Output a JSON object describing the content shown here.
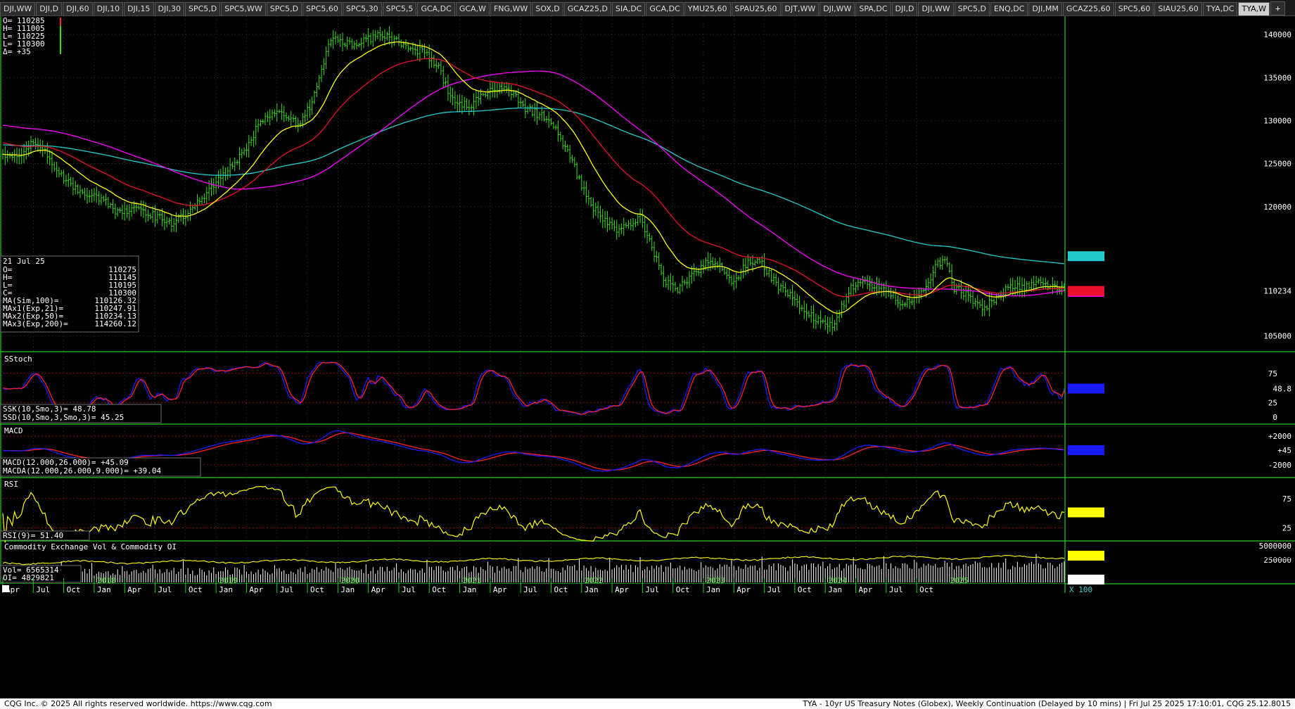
{
  "tabs": [
    {
      "label": "DJI,WW"
    },
    {
      "label": "DJI,D"
    },
    {
      "label": "DJI,60"
    },
    {
      "label": "DJI,10"
    },
    {
      "label": "DJI,15"
    },
    {
      "label": "DJI,30"
    },
    {
      "label": "SPC5,D"
    },
    {
      "label": "SPC5,WW"
    },
    {
      "label": "SPC5,D"
    },
    {
      "label": "SPC5,60"
    },
    {
      "label": "SPC5,30"
    },
    {
      "label": "SPC5,5"
    },
    {
      "label": "GCA,DC"
    },
    {
      "label": "GCA,W"
    },
    {
      "label": "FNG,WW"
    },
    {
      "label": "SOX,D"
    },
    {
      "label": "GCAZ25,D"
    },
    {
      "label": "SIA,DC"
    },
    {
      "label": "GCA,DC"
    },
    {
      "label": "YMU25,60"
    },
    {
      "label": "SPAU25,60"
    },
    {
      "label": "DJT,WW"
    },
    {
      "label": "DJI,WW"
    },
    {
      "label": "SPA,DC"
    },
    {
      "label": "DJI,D"
    },
    {
      "label": "DJI,WW"
    },
    {
      "label": "SPC5,D"
    },
    {
      "label": "ENQ,DC"
    },
    {
      "label": "DJI,MM"
    },
    {
      "label": "GCAZ25,60"
    },
    {
      "label": "SPC5,60"
    },
    {
      "label": "SIAU25,60"
    },
    {
      "label": "TYA,DC"
    },
    {
      "label": "TYA,W",
      "active": true
    }
  ],
  "tab_add": "+",
  "colors": {
    "bars": "#3cdc1e",
    "ma100": "#ff00ff",
    "ma21": "#ffff00",
    "ma50": "#e8102a",
    "ma200": "#22cccc",
    "border": "#22cc22",
    "stoch_k": "#1a1aff",
    "stoch_d": "#ff2020",
    "rsi": "#ffff00",
    "oi": "#ffff00",
    "vol": "#ffffff"
  },
  "price_panel": {
    "ohlc_box": {
      "lines": [
        "O= 110285",
        "H= 111005",
        "L= 110225",
        "L= 110300",
        "Δ=     +35"
      ]
    },
    "axis_ticks": [
      "140000",
      "135000",
      "130000",
      "125000",
      "120000",
      "105000"
    ],
    "marker_ma200": "114260",
    "marker_price": "110234",
    "info_box": {
      "date": "21 Jul 25",
      "rows": [
        {
          "k": "O=",
          "v": "110275"
        },
        {
          "k": "H=",
          "v": "111145"
        },
        {
          "k": "L=",
          "v": "110195"
        },
        {
          "k": "C=",
          "v": "110300"
        },
        {
          "k": "MA(Sim,100)=",
          "v": "110126.32"
        },
        {
          "k": "MAx1(Exp,21)=",
          "v": "110247.91"
        },
        {
          "k": "MAx2(Exp,50)=",
          "v": "110234.13"
        },
        {
          "k": "MAx3(Exp,200)=",
          "v": "114260.12"
        }
      ]
    }
  },
  "stoch_panel": {
    "title": "SStoch",
    "axis_ticks": [
      "75",
      "25",
      "0"
    ],
    "marker": "48.8",
    "legend": [
      "SSK(10,Smo,3)=       48.78",
      "SSD(10,Smo,3,Smo,3)=   45.25"
    ]
  },
  "macd_panel": {
    "title": "MACD",
    "axis_ticks": [
      "+2000",
      "-2000"
    ],
    "marker": "+45",
    "legend": [
      "MACD(12.000,26.000)=          +45.09",
      "MACDA(12.000,26.000,9.000)= +39.04"
    ]
  },
  "rsi_panel": {
    "title": "RSI",
    "axis_ticks": [
      "75",
      "25"
    ],
    "marker": "51.40",
    "legend": [
      "RSI(9)=   51.40"
    ]
  },
  "vol_panel": {
    "title": "Commodity Exchange Vol & Commodity OI",
    "axis_ticks": [
      "5000000",
      "250000"
    ],
    "marker_oi": "4829821",
    "marker_vol": "65653",
    "legend": [
      "Vol=    6565314",
      "OI=    4829821"
    ]
  },
  "time_axis": {
    "months": [
      {
        "t": "Apr",
        "i": 0
      },
      {
        "t": "Jul",
        "i": 13
      },
      {
        "t": "Oct",
        "i": 26
      },
      {
        "t": "Jan",
        "i": 39
      },
      {
        "t": "Apr",
        "i": 52
      },
      {
        "t": "Jul",
        "i": 65
      },
      {
        "t": "Oct",
        "i": 78
      },
      {
        "t": "Jan",
        "i": 91
      },
      {
        "t": "Apr",
        "i": 104
      },
      {
        "t": "Jul",
        "i": 117
      },
      {
        "t": "Oct",
        "i": 130
      },
      {
        "t": "Jan",
        "i": 143
      },
      {
        "t": "Apr",
        "i": 156
      },
      {
        "t": "Jul",
        "i": 169
      },
      {
        "t": "Oct",
        "i": 182
      },
      {
        "t": "Jan",
        "i": 195
      },
      {
        "t": "Apr",
        "i": 208
      },
      {
        "t": "Jul",
        "i": 221
      },
      {
        "t": "Oct",
        "i": 234
      },
      {
        "t": "Jan",
        "i": 247
      },
      {
        "t": "Apr",
        "i": 260
      },
      {
        "t": "Jul",
        "i": 273
      },
      {
        "t": "Oct",
        "i": 286
      },
      {
        "t": "Jan",
        "i": 299
      },
      {
        "t": "Apr",
        "i": 312
      },
      {
        "t": "Jul",
        "i": 325
      },
      {
        "t": "Oct",
        "i": 338
      },
      {
        "t": "Jan",
        "i": 351
      },
      {
        "t": "Apr",
        "i": 364
      },
      {
        "t": "Jul",
        "i": 377
      },
      {
        "t": "Oct",
        "i": 390
      }
    ],
    "years": [
      {
        "t": "2018",
        "i": 39
      },
      {
        "t": "2019",
        "i": 91
      },
      {
        "t": "2020",
        "i": 143
      },
      {
        "t": "2021",
        "i": 195
      },
      {
        "t": "2022",
        "i": 247
      },
      {
        "t": "2023",
        "i": 299
      },
      {
        "t": "2024",
        "i": 351
      },
      {
        "t": "2025",
        "i": 403
      }
    ],
    "corner": "X 100"
  },
  "chart_data": {
    "type": "ohlc",
    "symbol": "TYA",
    "interval": "weekly",
    "ylim": [
      103500,
      141800
    ],
    "anchors": [
      [
        0,
        126000
      ],
      [
        8,
        126200
      ],
      [
        14,
        127600
      ],
      [
        20,
        125600
      ],
      [
        26,
        123200
      ],
      [
        34,
        121500
      ],
      [
        42,
        121000
      ],
      [
        48,
        119400
      ],
      [
        56,
        119800
      ],
      [
        64,
        119000
      ],
      [
        72,
        118200
      ],
      [
        80,
        119400
      ],
      [
        90,
        122500
      ],
      [
        98,
        124800
      ],
      [
        104,
        126700
      ],
      [
        110,
        130000
      ],
      [
        118,
        131000
      ],
      [
        126,
        129500
      ],
      [
        132,
        132000
      ],
      [
        136,
        136000
      ],
      [
        140,
        139600
      ],
      [
        146,
        139200
      ],
      [
        150,
        138800
      ],
      [
        156,
        139500
      ],
      [
        162,
        139900
      ],
      [
        168,
        139200
      ],
      [
        174,
        138400
      ],
      [
        180,
        138000
      ],
      [
        186,
        136000
      ],
      [
        190,
        133400
      ],
      [
        194,
        131800
      ],
      [
        200,
        131900
      ],
      [
        206,
        133200
      ],
      [
        212,
        134000
      ],
      [
        218,
        133300
      ],
      [
        222,
        131600
      ],
      [
        228,
        130800
      ],
      [
        234,
        130000
      ],
      [
        240,
        127000
      ],
      [
        244,
        124500
      ],
      [
        250,
        120500
      ],
      [
        256,
        118500
      ],
      [
        262,
        117300
      ],
      [
        268,
        118200
      ],
      [
        272,
        119000
      ],
      [
        276,
        116000
      ],
      [
        282,
        111500
      ],
      [
        288,
        110500
      ],
      [
        294,
        111800
      ],
      [
        300,
        113600
      ],
      [
        306,
        113200
      ],
      [
        312,
        111000
      ],
      [
        318,
        113700
      ],
      [
        324,
        113400
      ],
      [
        330,
        111000
      ],
      [
        336,
        109800
      ],
      [
        342,
        108000
      ],
      [
        348,
        106800
      ],
      [
        354,
        106000
      ],
      [
        358,
        108300
      ],
      [
        362,
        110500
      ],
      [
        366,
        111500
      ],
      [
        372,
        110900
      ],
      [
        378,
        110000
      ],
      [
        384,
        108700
      ],
      [
        390,
        109300
      ],
      [
        394,
        110500
      ],
      [
        398,
        113200
      ],
      [
        402,
        114000
      ],
      [
        406,
        110600
      ],
      [
        412,
        109800
      ],
      [
        418,
        108100
      ],
      [
        424,
        109500
      ],
      [
        430,
        110700
      ],
      [
        436,
        110500
      ],
      [
        440,
        111400
      ],
      [
        444,
        110800
      ],
      [
        448,
        111100
      ],
      [
        453,
        110300
      ]
    ],
    "moving_averages": [
      {
        "name": "MA(Sim,100)",
        "last": 110126.32
      },
      {
        "name": "MAx1(Exp,21)",
        "last": 110247.91
      },
      {
        "name": "MAx2(Exp,50)",
        "last": 110234.13
      },
      {
        "name": "MAx3(Exp,200)",
        "last": 114260.12
      }
    ],
    "last_bar": {
      "date": "21 Jul 25",
      "open": 110275,
      "high": 111145,
      "low": 110195,
      "close": 110300
    },
    "stoch": {
      "k": 48.78,
      "d": 45.25,
      "range": [
        0,
        100
      ],
      "levels": [
        75,
        25
      ]
    },
    "macd": {
      "macd": 45.09,
      "signal": 39.04,
      "ylim": [
        -3200,
        3000
      ]
    },
    "rsi": {
      "value": 51.4,
      "range": [
        0,
        100
      ],
      "levels": [
        75,
        25
      ]
    },
    "volume": {
      "vol": 6565314,
      "oi": 4829821
    }
  },
  "footer": {
    "left": "CQG Inc. © 2025 All rights reserved worldwide. https://www.cqg.com",
    "right": "TYA - 10yr US Treasury Notes (Globex), Weekly Continuation (Delayed by 10 mins) | Fri Jul 25 2025 17:10:01, CQG 25.12.8015"
  }
}
